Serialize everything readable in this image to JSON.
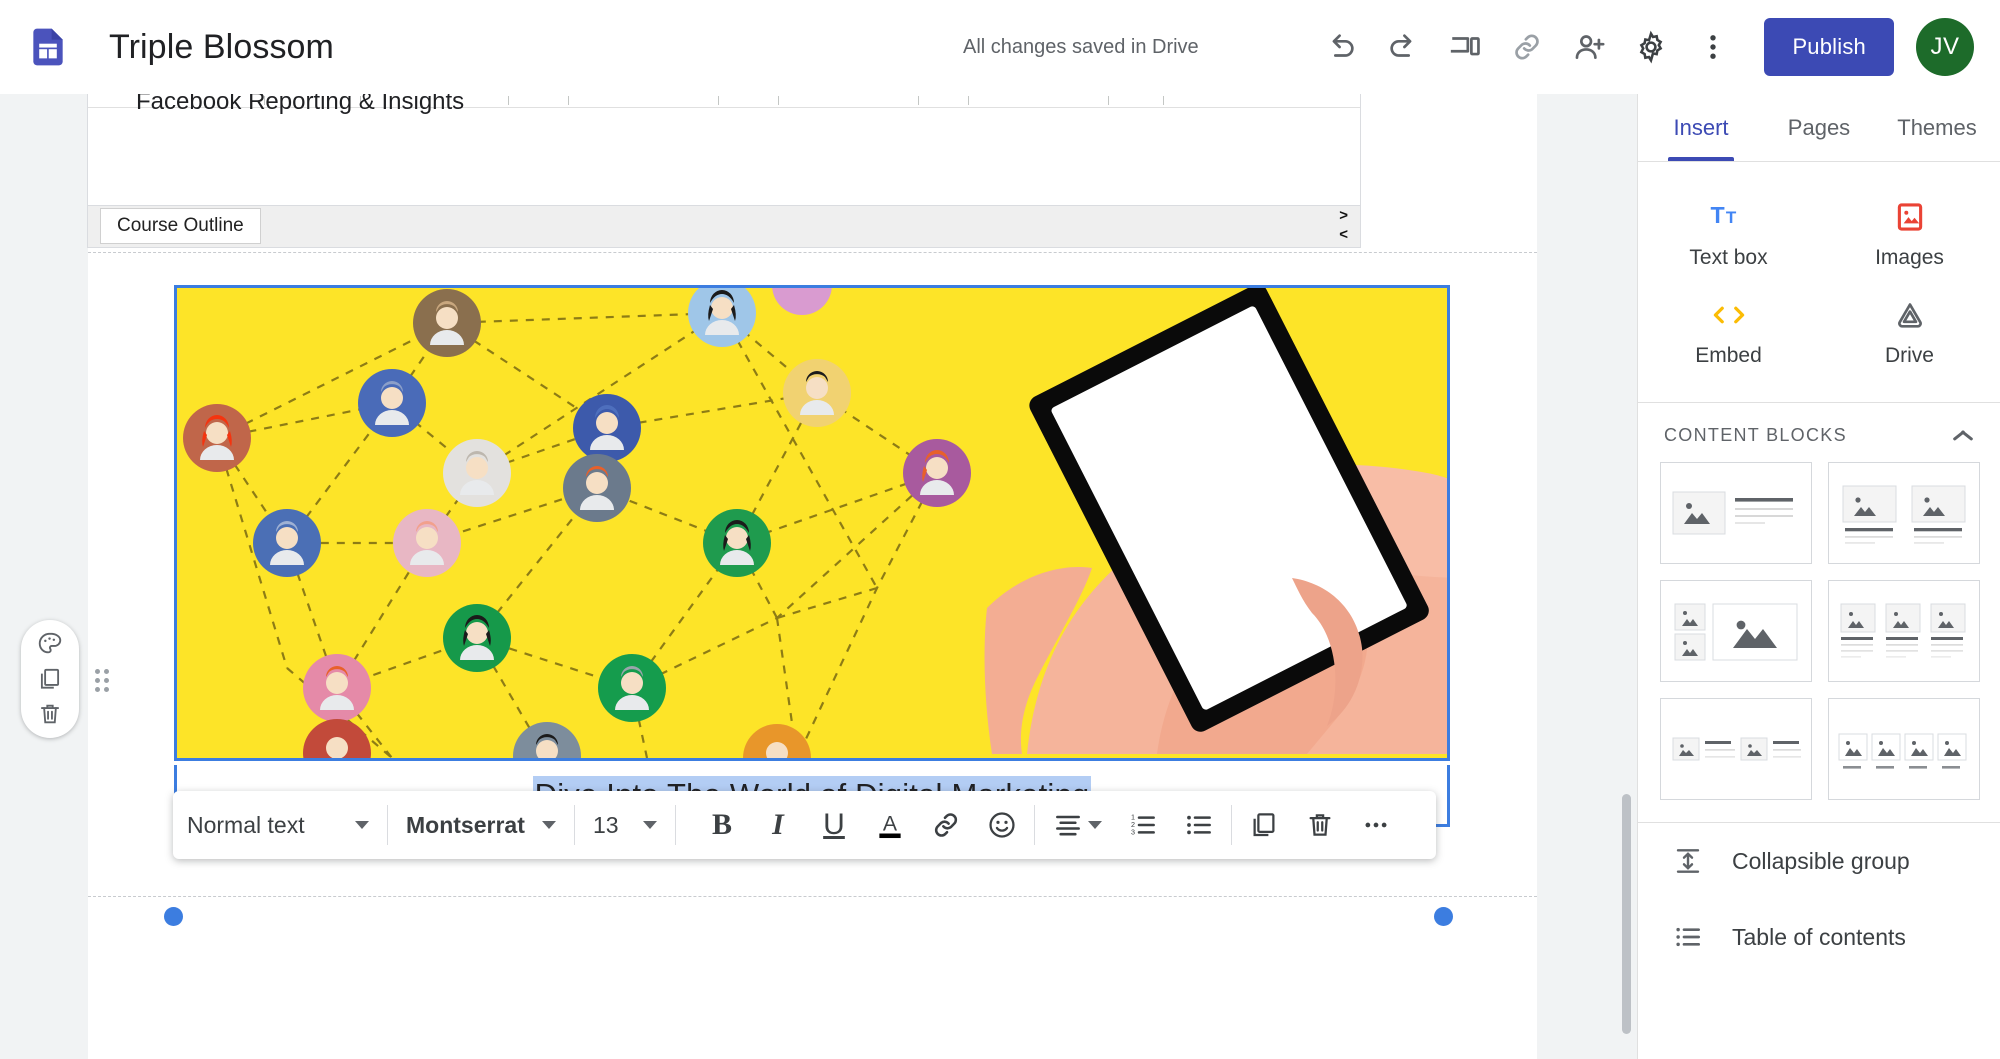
{
  "app": {
    "logo_icon": "google-sites-icon",
    "title": "Triple Blossom",
    "save_status": "All changes saved in Drive",
    "accent_color": "#3c4ab4",
    "icons": [
      {
        "name": "undo-icon",
        "label": "Undo"
      },
      {
        "name": "redo-icon",
        "label": "Redo"
      },
      {
        "name": "preview-devices-icon",
        "label": "Preview"
      },
      {
        "name": "link-icon",
        "label": "Copy page link"
      },
      {
        "name": "share-person-add-icon",
        "label": "Share with others"
      },
      {
        "name": "settings-gear-icon",
        "label": "Settings"
      },
      {
        "name": "more-vert-icon",
        "label": "More"
      }
    ],
    "publish_label": "Publish",
    "avatar_initials": "JV",
    "avatar_color": "#1d6b2a"
  },
  "canvas": {
    "embed": {
      "text": "Facebook Reporting & Insights",
      "sheet_tab": "Course Outline",
      "next_arrow": ">",
      "prev_arrow": "<"
    },
    "image_section": {
      "name": "digital-marketing-banner",
      "background_color": "#fde428",
      "selected": true
    },
    "text_section": {
      "value": "Dive Into The World of Digital Marketing",
      "selected": true,
      "selection_color": "#b3cdf4"
    },
    "left_tools": [
      {
        "name": "palette-icon",
        "label": "Section background"
      },
      {
        "name": "duplicate-icon",
        "label": "Duplicate section"
      },
      {
        "name": "delete-trash-icon",
        "label": "Delete section"
      }
    ],
    "drag_handle": "drag-dots-handle"
  },
  "text_toolbar": {
    "style": "Normal text",
    "font": "Montserrat",
    "size": "13",
    "buttons": [
      {
        "name": "bold-button",
        "glyph": "B"
      },
      {
        "name": "italic-button",
        "glyph": "I"
      },
      {
        "name": "underline-button",
        "glyph": "U"
      },
      {
        "name": "text-color-button",
        "glyph": "A"
      },
      {
        "name": "insert-link-button",
        "glyph": "link"
      },
      {
        "name": "insert-emoji-button",
        "glyph": "emoji"
      },
      {
        "name": "align-button",
        "glyph": "align"
      },
      {
        "name": "numbered-list-button",
        "glyph": "numbered-list"
      },
      {
        "name": "bulleted-list-button",
        "glyph": "bulleted-list"
      },
      {
        "name": "duplicate-button",
        "glyph": "duplicate"
      },
      {
        "name": "delete-button",
        "glyph": "trash"
      },
      {
        "name": "more-options-button",
        "glyph": "..."
      }
    ]
  },
  "sidebar": {
    "tabs": [
      {
        "label": "Insert",
        "active": true
      },
      {
        "label": "Pages",
        "active": false
      },
      {
        "label": "Themes",
        "active": false
      }
    ],
    "insert_items": [
      {
        "label": "Text box",
        "icon": "text-box-icon",
        "color": "#4285f4"
      },
      {
        "label": "Images",
        "icon": "images-icon",
        "color": "#ea4335"
      },
      {
        "label": "Embed",
        "icon": "embed-code-icon",
        "color": "#fbbc04"
      },
      {
        "label": "Drive",
        "icon": "google-drive-icon",
        "color": "#5f6368"
      }
    ],
    "content_blocks": {
      "title": "CONTENT BLOCKS",
      "collapse_icon": "chevron-up-icon",
      "layouts": [
        "image-left-text-right",
        "two-images-with-text",
        "two-small-one-large-image",
        "three-columns-image-text",
        "two-inline-image-text",
        "four-image-strip"
      ]
    },
    "list_items": [
      {
        "label": "Collapsible group",
        "icon": "collapsible-group-icon"
      },
      {
        "label": "Table of contents",
        "icon": "table-of-contents-icon"
      }
    ]
  }
}
